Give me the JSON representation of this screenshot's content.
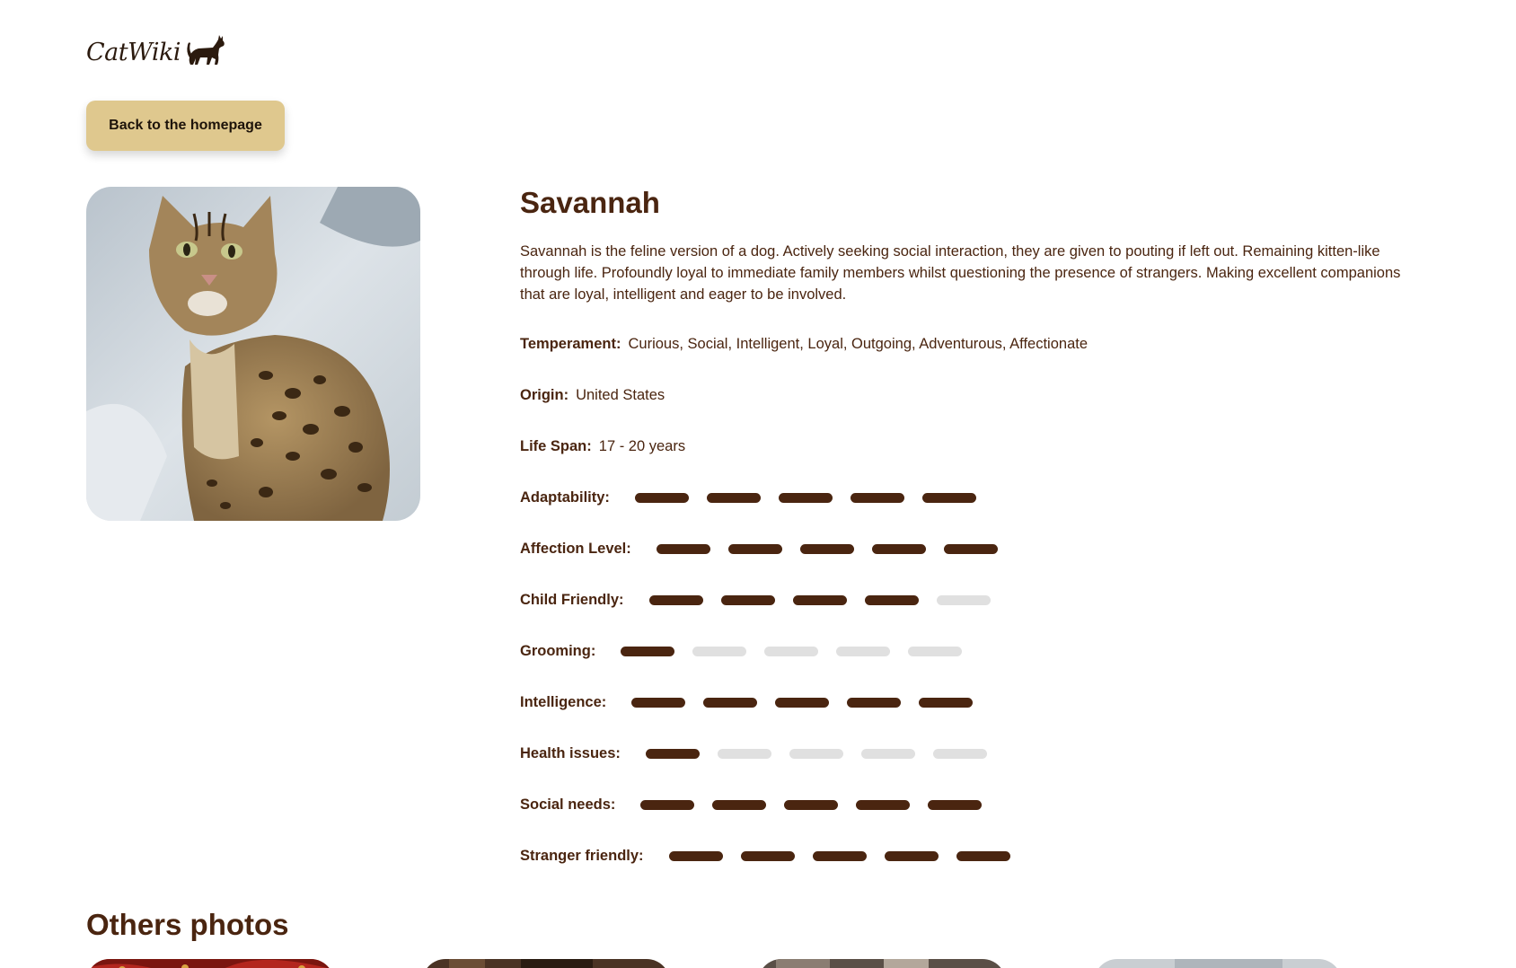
{
  "header": {
    "logo_text": "CatWiki",
    "logo_icon": "cat-silhouette-icon"
  },
  "nav": {
    "back_label": "Back to the homepage"
  },
  "breed": {
    "name": "Savannah",
    "description": "Savannah is the feline version of a dog. Actively seeking social interaction, they are given to pouting if left out. Remaining kitten-like through life. Profoundly loyal to immediate family members whilst questioning the presence of strangers. Making excellent companions that are loyal, intelligent and eager to be involved.",
    "temperament_label": "Temperament:",
    "temperament": "Curious, Social, Intelligent, Loyal, Outgoing, Adventurous, Affectionate",
    "origin_label": "Origin:",
    "origin": "United States",
    "life_span_label": "Life Span:",
    "life_span": "17 - 20 years"
  },
  "ratings": [
    {
      "label": "Adaptability:",
      "value": 5,
      "max": 5
    },
    {
      "label": "Affection Level:",
      "value": 5,
      "max": 5
    },
    {
      "label": "Child Friendly:",
      "value": 4,
      "max": 5
    },
    {
      "label": "Grooming:",
      "value": 1,
      "max": 5
    },
    {
      "label": "Intelligence:",
      "value": 5,
      "max": 5
    },
    {
      "label": "Health issues:",
      "value": 1,
      "max": 5
    },
    {
      "label": "Social needs:",
      "value": 5,
      "max": 5
    },
    {
      "label": "Stranger friendly:",
      "value": 5,
      "max": 5
    }
  ],
  "others": {
    "title": "Others photos"
  },
  "colors": {
    "accent": "#dfc88e",
    "brown": "#4a2510",
    "bar_off": "#e0e0e0"
  }
}
